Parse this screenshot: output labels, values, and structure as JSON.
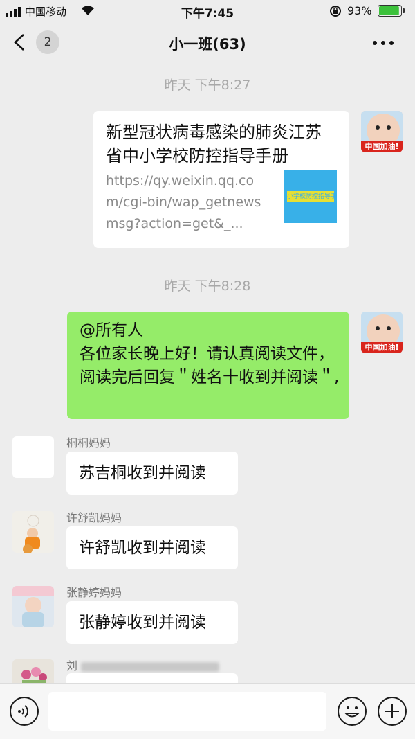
{
  "status_bar": {
    "carrier": "中国移动",
    "time": "下午7:45",
    "battery": "93%",
    "battery_level": 0.93
  },
  "header": {
    "title": "小一班(63)",
    "unread_badge": "2"
  },
  "messages": {
    "timestamp_1": "昨天 下午8:27",
    "link_card": {
      "title": "新型冠状病毒感染的肺炎江苏省中小学校防控指导手册",
      "url": "https://qy.weixin.qq.com/cgi-bin/wap_getnewsmsg?action=get&_...",
      "thumb_text": "小学校防控指导手"
    },
    "timestamp_2": "昨天 下午8:28",
    "announcement": "@所有人\n各位家长晚上好！请认真阅读文件，阅读完后回复＂姓名十收到并阅读＂,",
    "self_avatar_caption": "中国加油!",
    "replies": [
      {
        "sender": "桐桐妈妈",
        "text": "苏吉桐收到并阅读"
      },
      {
        "sender": "许舒凯妈妈",
        "text": "许舒凯收到并阅读"
      },
      {
        "sender": "张静婷妈妈",
        "text": "张静婷收到并阅读"
      }
    ],
    "blurred_sender": "刘"
  },
  "input_bar": {
    "voice_icon": "voice-icon",
    "emoji_icon": "emoji-icon",
    "plus_icon": "plus-icon"
  }
}
